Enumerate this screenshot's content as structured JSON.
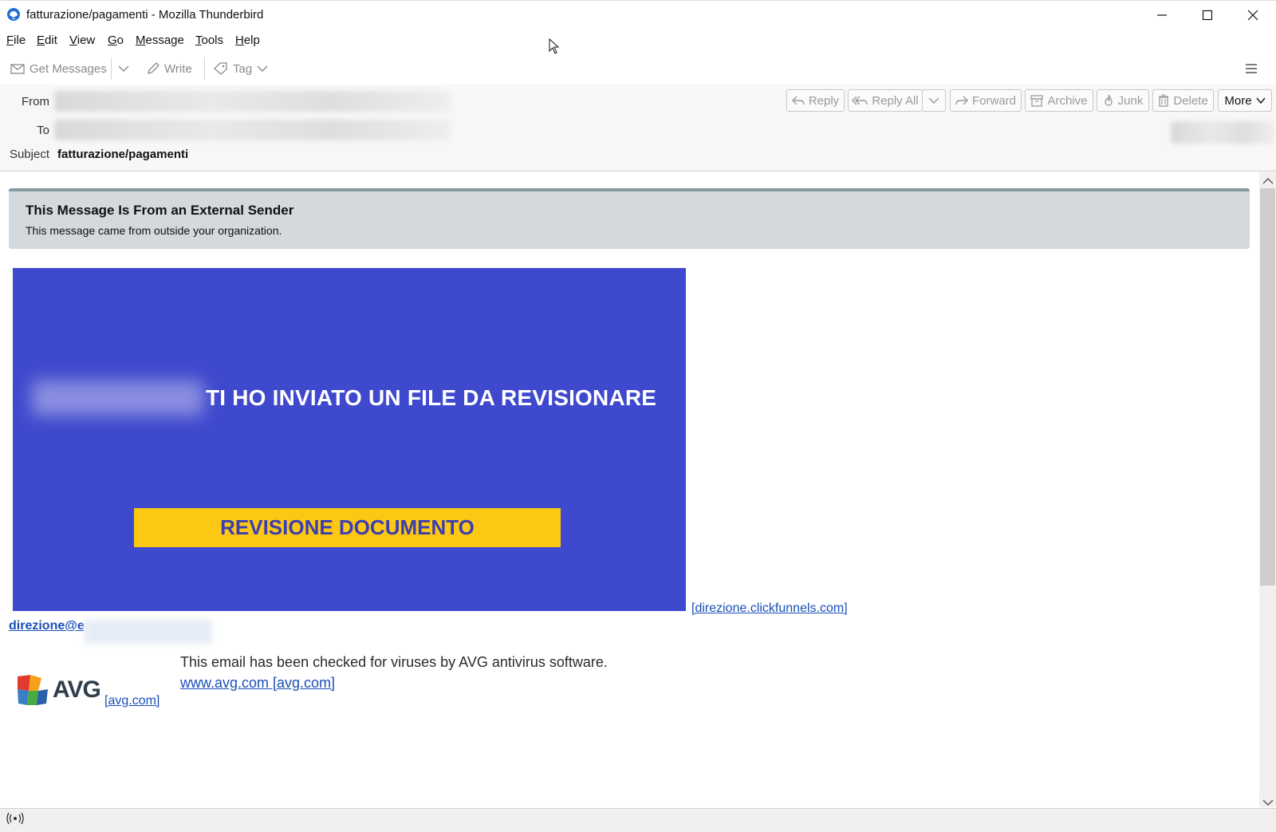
{
  "window": {
    "title": "fatturazione/pagamenti - Mozilla Thunderbird"
  },
  "menu": {
    "items": [
      {
        "first": "F",
        "rest": "ile"
      },
      {
        "first": "E",
        "rest": "dit"
      },
      {
        "first": "V",
        "rest": "iew"
      },
      {
        "first": "G",
        "rest": "o"
      },
      {
        "first": "M",
        "rest": "essage"
      },
      {
        "first": "T",
        "rest": "ools"
      },
      {
        "first": "H",
        "rest": "elp"
      }
    ]
  },
  "toolbar": {
    "get_messages": "Get Messages",
    "write": "Write",
    "tag": "Tag"
  },
  "header": {
    "from_label": "From",
    "to_label": "To",
    "subject_label": "Subject",
    "subject_value": "fatturazione/pagamenti",
    "buttons": {
      "reply": "Reply",
      "reply_all": "Reply All",
      "forward": "Forward",
      "archive": "Archive",
      "junk": "Junk",
      "delete": "Delete",
      "more": "More"
    }
  },
  "body": {
    "banner_title": "This Message Is From an External Sender",
    "banner_subtitle": "This message came from outside your organization.",
    "hero_text": "TI HO INVIATO UN FILE DA REVISIONARE",
    "hero_button": "REVISIONE DOCUMENTO",
    "hero_link": "[direzione.clickfunnels.com]",
    "email_link": "direzione@e",
    "avg_text": "This email has been checked for viruses by AVG antivirus software.",
    "avg_link": "www.avg.com [avg.com]",
    "avg_logo_text": "AVG",
    "avg_logo_link": "[avg.com]"
  },
  "colors": {
    "hero_bg": "#3f49cd",
    "cta_bg": "#fdc813",
    "cta_text": "#3b3eb0",
    "banner_bg": "#d3d9dd",
    "link": "#1a4fb8"
  }
}
